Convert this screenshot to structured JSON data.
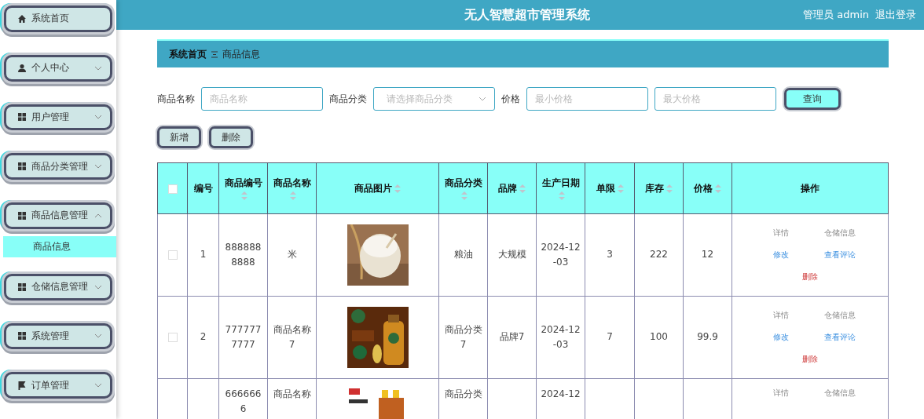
{
  "header": {
    "title": "无人智慧超市管理系统",
    "user": "管理员 admin",
    "logout": "退出登录"
  },
  "sidebar": {
    "items": [
      {
        "label": "系统首页",
        "kind": "link",
        "expanded": false
      },
      {
        "label": "个人中心",
        "kind": "menu",
        "expanded": false
      },
      {
        "label": "用户管理",
        "kind": "menu",
        "expanded": false
      },
      {
        "label": "商品分类管理",
        "kind": "menu",
        "expanded": false
      },
      {
        "label": "商品信息管理",
        "kind": "menu",
        "expanded": true,
        "children": [
          {
            "label": "商品信息",
            "selected": true
          }
        ]
      },
      {
        "label": "仓储信息管理",
        "kind": "menu",
        "expanded": false
      },
      {
        "label": "系统管理",
        "kind": "menu",
        "expanded": false
      },
      {
        "label": "订单管理",
        "kind": "menu",
        "expanded": false
      }
    ]
  },
  "breadcrumb": [
    {
      "label": "系统首页"
    },
    {
      "label": "商品信息"
    }
  ],
  "search": {
    "fields": [
      {
        "label": "商品名称",
        "placeholder": "商品名称",
        "kind": "input"
      },
      {
        "label": "商品分类",
        "placeholder": "请选择商品分类",
        "kind": "select"
      },
      {
        "label": "价格",
        "placeholder": "最小价格",
        "kind": "input"
      },
      {
        "placeholder": "最大价格",
        "kind": "input"
      }
    ],
    "button": "查询"
  },
  "actions": [
    "新增",
    "删除"
  ],
  "table": {
    "select_all": {
      "checked": false
    },
    "columns": [
      {
        "label": "编号",
        "sortable": false
      },
      {
        "label": "商品编号",
        "sortable": true
      },
      {
        "label": "商品名称",
        "sortable": true
      },
      {
        "label": "商品图片",
        "sortable": true
      },
      {
        "label": "商品分类",
        "sortable": true
      },
      {
        "label": "品牌",
        "sortable": true
      },
      {
        "label": "生产日期",
        "sortable": true
      },
      {
        "label": "单限",
        "sortable": true
      },
      {
        "label": "库存",
        "sortable": true
      },
      {
        "label": "价格",
        "sortable": true
      },
      {
        "label": "操作",
        "sortable": false
      }
    ],
    "rows": [
      {
        "checked": false,
        "cells": [
          "1",
          "8888888888",
          "米",
          "",
          "粮油",
          "大规模",
          "2024-12-03",
          "3",
          "222",
          "12"
        ],
        "actions": [
          {
            "label": "详情",
            "kind": "plain"
          },
          {
            "label": "仓储信息",
            "kind": "plain"
          },
          {
            "label": "修改",
            "kind": "link"
          },
          {
            "label": "查看评论",
            "kind": "link"
          },
          {
            "label": "删除",
            "kind": "danger"
          }
        ]
      },
      {
        "checked": false,
        "cells": [
          "2",
          "7777777777",
          "商品名称7",
          "",
          "商品分类7",
          "品牌7",
          "2024-12-03",
          "7",
          "100",
          "99.9"
        ],
        "actions": [
          {
            "label": "详情",
            "kind": "plain"
          },
          {
            "label": "仓储信息",
            "kind": "plain"
          },
          {
            "label": "修改",
            "kind": "link"
          },
          {
            "label": "查看评论",
            "kind": "link"
          },
          {
            "label": "删除",
            "kind": "danger"
          }
        ]
      },
      {
        "cells": [
          "",
          "6666666",
          "商品名称",
          "",
          "商品分类",
          "",
          "2024-12",
          "",
          "",
          ""
        ],
        "actions": [
          {
            "label": "详情",
            "kind": "plain"
          },
          {
            "label": "仓储信息",
            "kind": "plain"
          }
        ]
      }
    ]
  }
}
